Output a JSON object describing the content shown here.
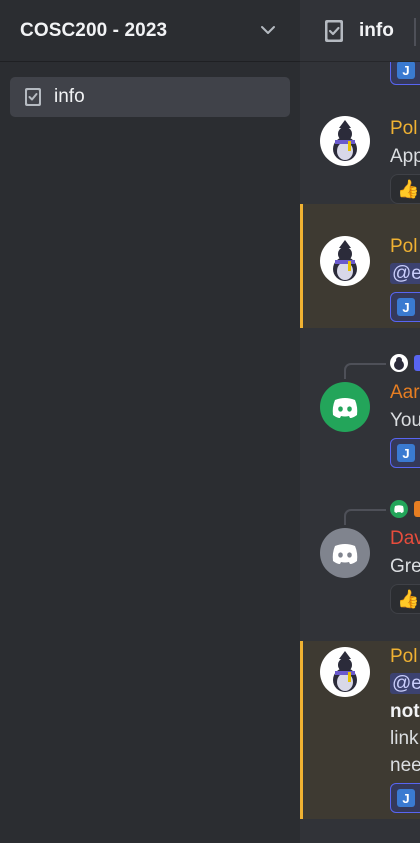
{
  "sidebar": {
    "server_name": "COSC200 - 2023",
    "channels": [
      {
        "label": "info",
        "icon": "rules-book-icon"
      }
    ]
  },
  "main": {
    "header_title": "info",
    "header_icon": "rules-book-icon",
    "messages": [
      {
        "author": "Pol",
        "author_color": "#f0b232",
        "lines": [
          "App"
        ],
        "reaction": "👍",
        "avatar": "penguin-avatar",
        "highlighted": false
      },
      {
        "author": "Pol",
        "author_color": "#f0b232",
        "lines": [
          "@e"
        ],
        "chip": "J",
        "avatar": "penguin-avatar",
        "highlighted": true
      },
      {
        "author": "Aar",
        "author_color": "#e67e22",
        "lines": [
          "You"
        ],
        "chip": "J",
        "avatar": "discord-avatar-green",
        "highlighted": false
      },
      {
        "author": "Dav",
        "author_color": "#e74c3c",
        "lines": [
          "Gre"
        ],
        "reaction": "👍",
        "avatar": "discord-avatar-grey",
        "highlighted": false
      },
      {
        "author": "Pol",
        "author_color": "#f0b232",
        "lines": [
          "@e",
          "not",
          "link",
          "nee"
        ],
        "chip": "J",
        "avatar": "penguin-avatar",
        "highlighted": true
      }
    ],
    "top_chip": "J"
  },
  "colors": {
    "accent": "#5865f2",
    "highlight_bar": "#f0b232",
    "mention_bg": "#3c4270"
  }
}
